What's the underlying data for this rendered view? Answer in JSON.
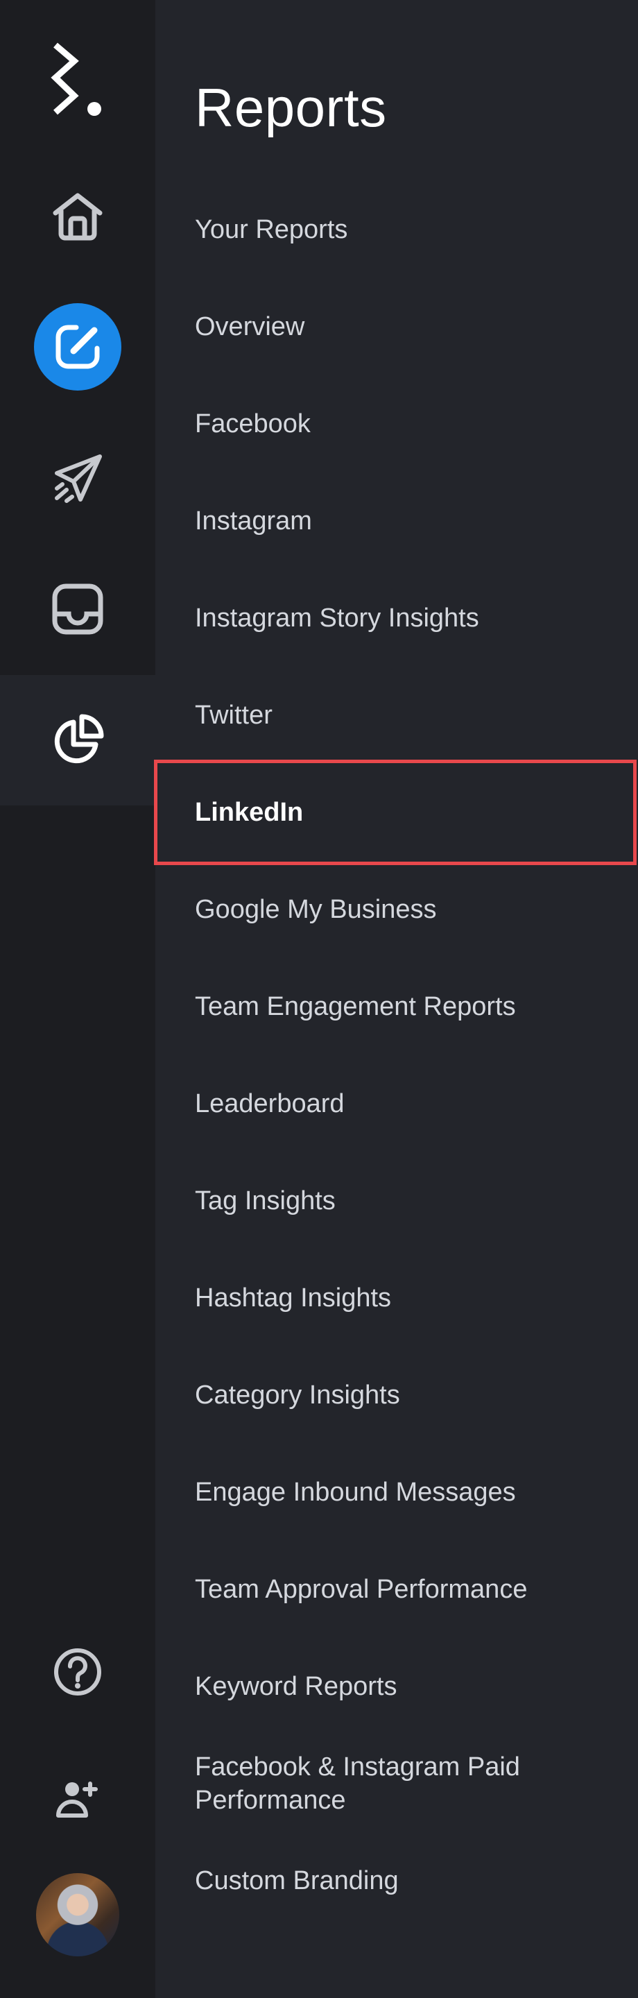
{
  "rail": {
    "items": [
      {
        "name": "home",
        "icon": "home-icon"
      },
      {
        "name": "compose",
        "icon": "compose-icon",
        "accent": "#1a88e8"
      },
      {
        "name": "publish",
        "icon": "paper-plane-icon"
      },
      {
        "name": "inbox",
        "icon": "inbox-icon"
      },
      {
        "name": "reports",
        "icon": "pie-chart-icon",
        "active": true
      }
    ],
    "bottom": [
      {
        "name": "help",
        "icon": "help-circle-icon"
      },
      {
        "name": "invite-user",
        "icon": "user-plus-icon"
      },
      {
        "name": "profile",
        "icon": "avatar"
      }
    ]
  },
  "panel": {
    "title": "Reports",
    "items": [
      {
        "label": "Your Reports"
      },
      {
        "label": "Overview"
      },
      {
        "label": "Facebook"
      },
      {
        "label": "Instagram"
      },
      {
        "label": "Instagram Story Insights"
      },
      {
        "label": "Twitter"
      },
      {
        "label": "LinkedIn",
        "selected": true
      },
      {
        "label": "Google My Business"
      },
      {
        "label": "Team Engagement Reports"
      },
      {
        "label": "Leaderboard"
      },
      {
        "label": "Tag Insights"
      },
      {
        "label": "Hashtag Insights"
      },
      {
        "label": "Category Insights"
      },
      {
        "label": "Engage Inbound Messages"
      },
      {
        "label": "Team Approval Performance"
      },
      {
        "label": "Keyword Reports"
      },
      {
        "label": "Facebook & Instagram Paid Performance"
      },
      {
        "label": "Custom Branding"
      }
    ]
  },
  "colors": {
    "rail_bg": "#1c1d21",
    "panel_bg": "#23252b",
    "accent": "#1a88e8",
    "highlight": "#e8484c",
    "text": "#d5d8de"
  }
}
